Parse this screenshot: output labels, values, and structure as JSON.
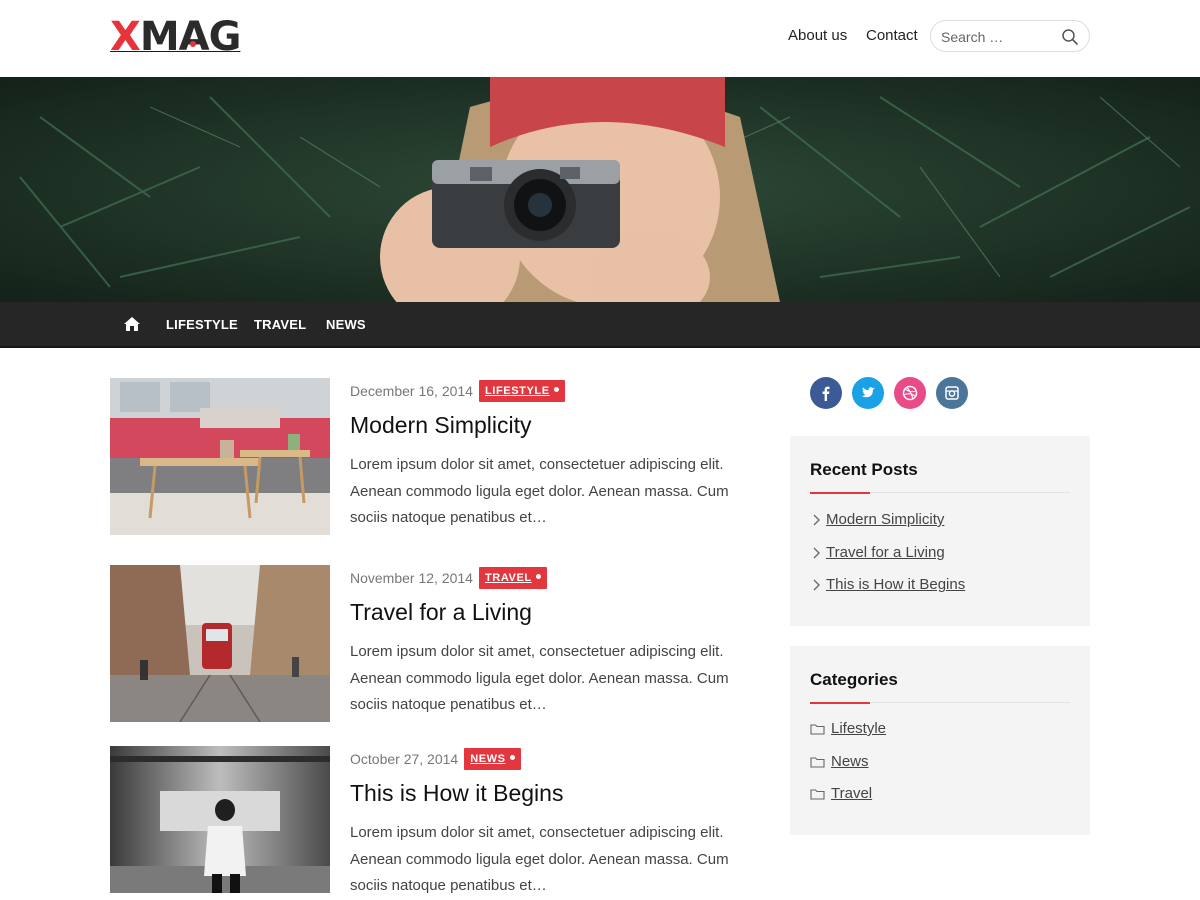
{
  "brand": {
    "logo_text": "XMAG",
    "logo_first_letter": "X",
    "logo_rest": "MAG",
    "accent": "#e2373f"
  },
  "header": {
    "nav": [
      "About us",
      "Contact"
    ],
    "search_placeholder": "Search …"
  },
  "hero": {
    "image": "woman-in-red-beanie-with-camera-among-pine-branches"
  },
  "menu": {
    "home_icon": "home-icon",
    "items": [
      "LIFESTYLE",
      "TRAVEL",
      "NEWS"
    ]
  },
  "posts": [
    {
      "date": "December 16, 2014",
      "category": "LIFESTYLE",
      "title": "Modern Simplicity",
      "excerpt": "Lorem ipsum dolor sit amet, consectetuer adipiscing elit. Aenean commodo ligula eget dolor. Aenean massa. Cum sociis natoque penatibus et…",
      "thumbnail": "pink-sofa-wooden-tables"
    },
    {
      "date": "November 12, 2014",
      "category": "TRAVEL",
      "title": "Travel for a Living",
      "excerpt": "Lorem ipsum dolor sit amet, consectetuer adipiscing elit. Aenean commodo ligula eget dolor. Aenean massa. Cum sociis natoque penatibus et…",
      "thumbnail": "red-tram-city-street"
    },
    {
      "date": "October 27, 2014",
      "category": "NEWS",
      "title": "This is How it Begins",
      "excerpt": "Lorem ipsum dolor sit amet, consectetuer adipiscing elit. Aenean commodo ligula eget dolor. Aenean massa. Cum sociis natoque penatibus et…",
      "thumbnail": "woman-beside-moving-train"
    }
  ],
  "sidebar": {
    "social": [
      {
        "name": "facebook-icon",
        "color": "#3b5a96"
      },
      {
        "name": "twitter-icon",
        "color": "#1ba1e6"
      },
      {
        "name": "dribbble-icon",
        "color": "#e94a88"
      },
      {
        "name": "instagram-icon",
        "color": "#4b7599"
      }
    ],
    "recent_posts": {
      "title": "Recent Posts",
      "items": [
        "Modern Simplicity",
        "Travel for a Living",
        "This is How it Begins"
      ]
    },
    "categories": {
      "title": "Categories",
      "items": [
        "Lifestyle",
        "News",
        "Travel"
      ]
    }
  }
}
